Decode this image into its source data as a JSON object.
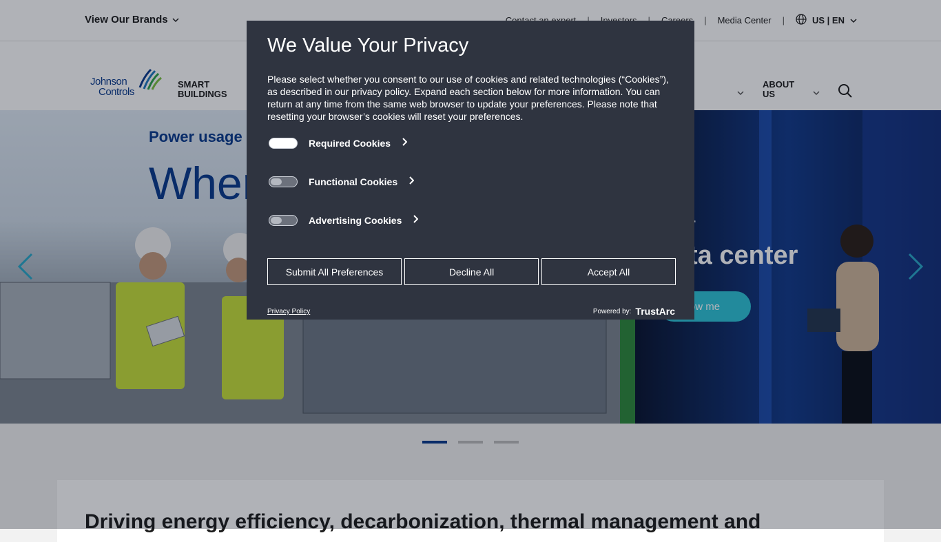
{
  "topbar": {
    "brands_label": "View Our Brands",
    "links": [
      "Contact an expert",
      "Investors",
      "Careers",
      "Media Center"
    ],
    "language": "US | EN"
  },
  "logo": {
    "line1": "Johnson",
    "line2": "Controls"
  },
  "nav": {
    "smart_buildings": [
      "SMART",
      "BUILDINGS"
    ],
    "about_us": [
      "ABOUT",
      "US"
    ]
  },
  "hero": {
    "kicker": "Power usage",
    "headline": "Wher",
    "right_title_1": "r",
    "right_title_2": "ta center",
    "cta_label": "ow me"
  },
  "carousel": {
    "count": 3,
    "active": 0
  },
  "section": {
    "title": "Driving energy efficiency, decarbonization, thermal management and"
  },
  "modal": {
    "title": "We Value Your Privacy",
    "description": "Please select whether you consent to our use of cookies and related technologies (“Cookies”), as described in our privacy policy. Expand each section below for more information. You can return at any time from the same web browser to update your preferences. Please note that resetting your browser’s cookies will reset your preferences.",
    "categories": [
      {
        "label": "Required Cookies",
        "enabled": true
      },
      {
        "label": "Functional Cookies",
        "enabled": false
      },
      {
        "label": "Advertising Cookies",
        "enabled": false
      }
    ],
    "buttons": {
      "submit": "Submit All Preferences",
      "decline": "Decline All",
      "accept": "Accept All"
    },
    "privacy_link": "Privacy Policy",
    "powered_by": "Powered by:",
    "provider": "TrustArc"
  },
  "colors": {
    "brand_blue": "#0a3a8c",
    "modal_bg": "#2f3440",
    "cta_teal": "#2ec5d8"
  },
  "icons": [
    "chevron-down-icon",
    "globe-icon",
    "search-icon",
    "chevron-right-icon",
    "arrow-left-icon",
    "arrow-right-icon"
  ]
}
